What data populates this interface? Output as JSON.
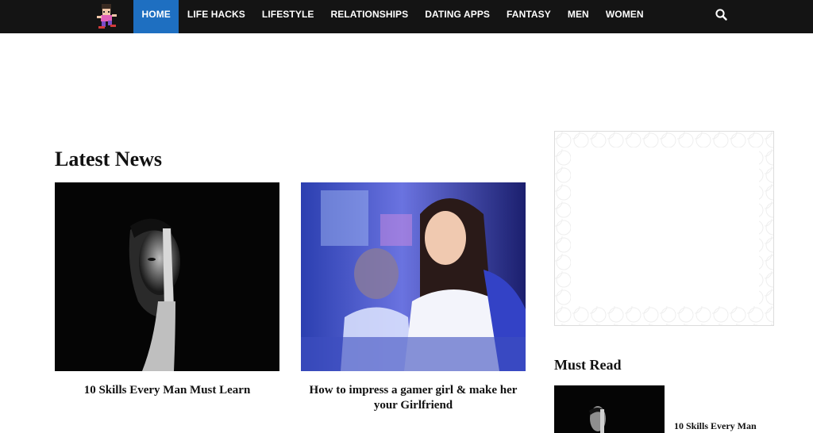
{
  "nav": {
    "items": [
      {
        "label": "HOME",
        "active": true
      },
      {
        "label": "LIFE HACKS"
      },
      {
        "label": "LIFESTYLE"
      },
      {
        "label": "RELATIONSHIPS"
      },
      {
        "label": "DATING APPS"
      },
      {
        "label": "FANTASY"
      },
      {
        "label": "MEN"
      },
      {
        "label": "WOMEN"
      }
    ],
    "active_color": "#1e6fc1",
    "bar_color": "#141414",
    "search_icon": "search-icon"
  },
  "latest": {
    "title": "Latest News",
    "cards": [
      {
        "title": "10 Skills Every Man Must Learn"
      },
      {
        "title": "How to impress a gamer girl & make her your Girlfriend"
      }
    ]
  },
  "sidebar": {
    "must_read_title": "Must Read",
    "must_read_items": [
      {
        "title": "10 Skills Every Man"
      }
    ]
  }
}
